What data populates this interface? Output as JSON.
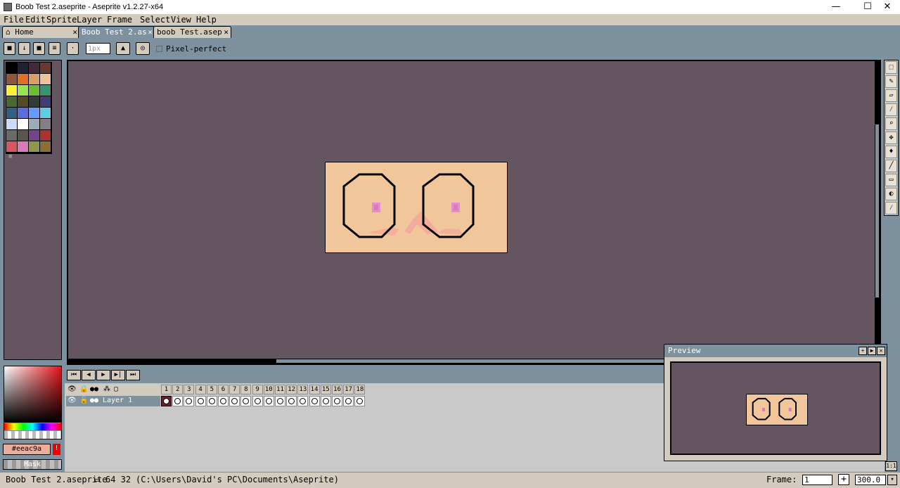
{
  "window": {
    "title": "Boob Test 2.aseprite - Aseprite v1.2.27-x64",
    "minimize": "—",
    "maximize": "☐",
    "close": "✕"
  },
  "menu": [
    "File",
    "Edit",
    "Sprite",
    "Layer",
    "Frame",
    "Select",
    "View",
    "Help"
  ],
  "tabs": [
    {
      "label": "Home",
      "close": "✕"
    },
    {
      "label": "Boob Test 2.as",
      "close": "✕"
    },
    {
      "label": "boob Test.asep",
      "close": "✕"
    }
  ],
  "context_bar": {
    "brush_size": "1px",
    "pixel_perfect_label": "Pixel-perfect",
    "pixel_perfect_checked": false
  },
  "palette": {
    "colors": [
      "#000000",
      "#222034",
      "#45283c",
      "#663931",
      "#8f563b",
      "#df7126",
      "#d9a066",
      "#eec39a",
      "#fbf236",
      "#99e550",
      "#6abe30",
      "#37946e",
      "#4b692f",
      "#524b24",
      "#323c39",
      "#3f3f74",
      "#306082",
      "#5b6ee1",
      "#639bff",
      "#5fcde4",
      "#cbdbfc",
      "#ffffff",
      "#9badb7",
      "#847e87",
      "#696a6a",
      "#595652",
      "#76428a",
      "#ac3232",
      "#d95763",
      "#d77bba",
      "#8f974a",
      "#8a6f30"
    ],
    "menu_glyph": "≡"
  },
  "color_bar": {
    "fg_hex": "#eeac9a",
    "warning_glyph": "!",
    "mask_label": "Mask"
  },
  "tools": [
    "marquee-icon",
    "pencil-icon",
    "eraser-icon",
    "eyedropper-icon",
    "zoom-icon",
    "move-icon",
    "paint-bucket-icon",
    "line-icon",
    "rectangle-icon",
    "blur-icon",
    "spray-icon"
  ],
  "timeline": {
    "buttons": [
      "⏮",
      "◀",
      "▶",
      "▶|",
      "⏭"
    ],
    "frames": [
      "1",
      "2",
      "3",
      "4",
      "5",
      "6",
      "7",
      "8",
      "9",
      "10",
      "11",
      "12",
      "13",
      "14",
      "15",
      "16",
      "17",
      "18"
    ],
    "layer_name": "Layer 1",
    "header_icons": [
      "eye-icon",
      "lock-icon",
      "continuous-icon",
      "link-icon",
      "frame-icon"
    ]
  },
  "preview": {
    "title": "Preview"
  },
  "status": {
    "filename": "Boob Test 2.aseprite",
    "dimensions": "64 32",
    "path": "(C:\\Users\\David's PC\\Documents\\Aseprite)",
    "frame_label": "Frame:",
    "frame_value": "1",
    "add_frame": "+",
    "zoom": "300.0",
    "zoom_arrow": "▾"
  }
}
